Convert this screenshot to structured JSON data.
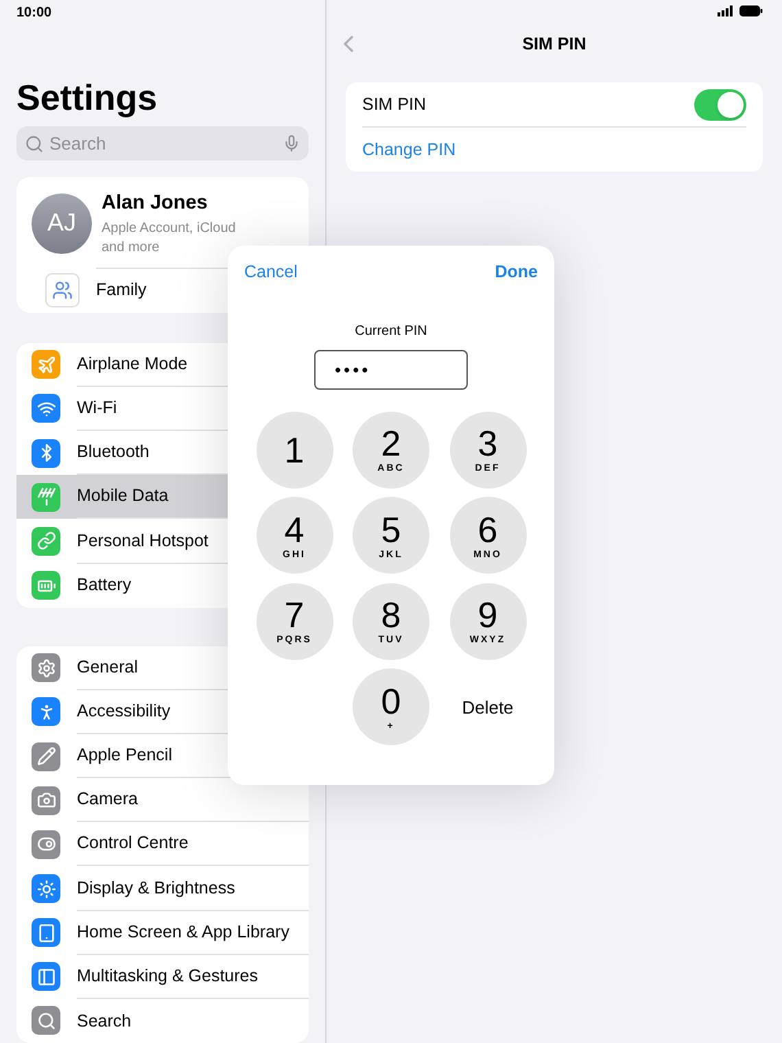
{
  "status_bar": {
    "time": "10:00"
  },
  "sidebar": {
    "title": "Settings",
    "search": {
      "placeholder": "Search"
    },
    "profile": {
      "initials": "AJ",
      "name": "Alan Jones",
      "subtitle": "Apple Account, iCloud and more"
    },
    "family": {
      "label": "Family"
    },
    "groups": [
      {
        "items": [
          {
            "label": "Airplane Mode",
            "color": "#f7a00a",
            "selected": false
          },
          {
            "label": "Wi-Fi",
            "color": "#1a82fb",
            "selected": false
          },
          {
            "label": "Bluetooth",
            "color": "#1a82fb",
            "selected": false
          },
          {
            "label": "Mobile Data",
            "color": "#34c759",
            "selected": true
          },
          {
            "label": "Personal Hotspot",
            "color": "#34c759",
            "selected": false
          },
          {
            "label": "Battery",
            "color": "#34c759",
            "selected": false
          }
        ]
      },
      {
        "items": [
          {
            "label": "General",
            "color": "#8e8e93",
            "selected": false
          },
          {
            "label": "Accessibility",
            "color": "#1a82fb",
            "selected": false
          },
          {
            "label": "Apple Pencil",
            "color": "#8e8e93",
            "selected": false
          },
          {
            "label": "Camera",
            "color": "#8e8e93",
            "selected": false
          },
          {
            "label": "Control Centre",
            "color": "#8e8e93",
            "selected": false
          },
          {
            "label": "Display & Brightness",
            "color": "#1a82fb",
            "selected": false
          },
          {
            "label": "Home Screen & App Library",
            "color": "#1a82fb",
            "selected": false
          },
          {
            "label": "Multitasking & Gestures",
            "color": "#1a82fb",
            "selected": false
          },
          {
            "label": "Search",
            "color": "#8e8e93",
            "selected": false
          }
        ]
      }
    ]
  },
  "detail": {
    "title": "SIM PIN",
    "rows": [
      {
        "kind": "toggle",
        "label": "SIM PIN",
        "on": true
      },
      {
        "kind": "link",
        "label": "Change PIN"
      }
    ]
  },
  "pin_dialog": {
    "cancel": "Cancel",
    "done": "Done",
    "label": "Current PIN",
    "value": "••••",
    "keys": [
      {
        "digit": "1"
      },
      {
        "digit": "2",
        "letters": "ABC"
      },
      {
        "digit": "3",
        "letters": "DEF"
      },
      {
        "digit": "4",
        "letters": "GHI"
      },
      {
        "digit": "5",
        "letters": "JKL"
      },
      {
        "digit": "6",
        "letters": "MNO"
      },
      {
        "digit": "7",
        "letters": "PQRS"
      },
      {
        "digit": "8",
        "letters": "TUV"
      },
      {
        "digit": "9",
        "letters": "WXYZ"
      },
      {
        "digit": "0",
        "letters": "+"
      }
    ],
    "delete": "Delete"
  }
}
